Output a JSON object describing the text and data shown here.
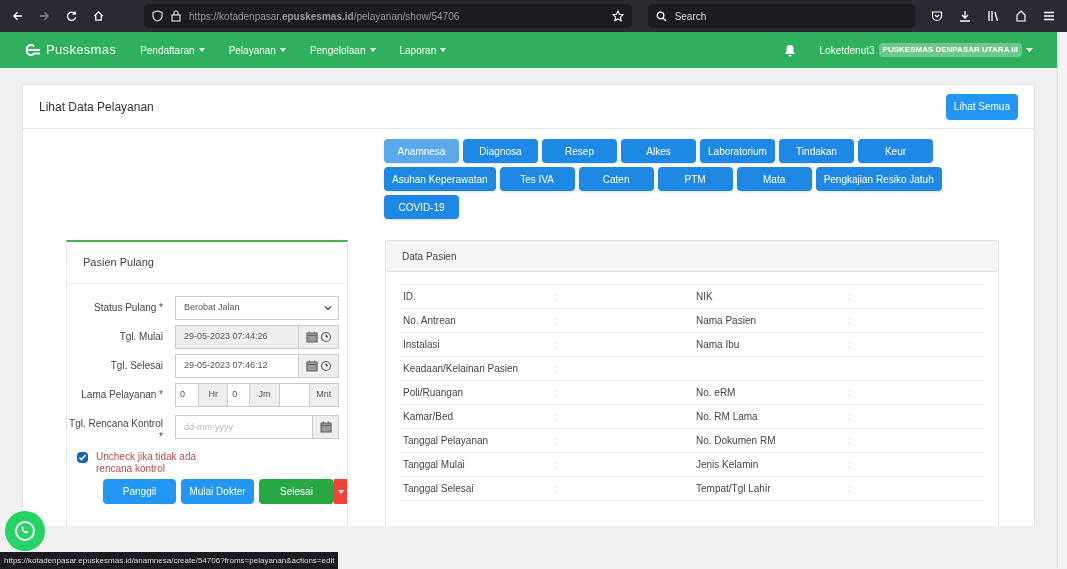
{
  "browser": {
    "url": "https://kotadenpasar.**epuskesmas.id**/pelayanan/show/54706",
    "search_placeholder": "Search"
  },
  "navbar": {
    "brand": "Puskesmas",
    "menus": [
      {
        "label": "Pendaftaran"
      },
      {
        "label": "Pelayanan"
      },
      {
        "label": "Pengelolaan"
      },
      {
        "label": "Laporan"
      }
    ],
    "user": "Loketdenut3",
    "facility": "PUSKESMAS DENPASAR UTARA III"
  },
  "page": {
    "title": "Lihat Data Pelayanan",
    "action": "Lihat Semua"
  },
  "tabs": [
    {
      "label": "Anamnesa",
      "selected": true
    },
    {
      "label": "Diagnosa",
      "selected": false
    },
    {
      "label": "Resep",
      "selected": false
    },
    {
      "label": "Alkes",
      "selected": false
    },
    {
      "label": "Laboratorium",
      "selected": false
    },
    {
      "label": "Tindakan",
      "selected": false
    },
    {
      "label": "Keur",
      "selected": false
    },
    {
      "label": "Asuhan Keperawatan",
      "selected": false
    },
    {
      "label": "Tes IVA",
      "selected": false
    },
    {
      "label": "Caten",
      "selected": false
    },
    {
      "label": "PTM",
      "selected": false
    },
    {
      "label": "Mata",
      "selected": false
    },
    {
      "label": "Pengkajian Resiko Jatuh",
      "selected": false
    },
    {
      "label": "COVID-19",
      "selected": false
    }
  ],
  "discharge": {
    "title": "Pasien Pulang",
    "fields": [
      {
        "kind": "select",
        "label": "Status Pulang *",
        "value": "Berobat Jalan",
        "disabled": false
      },
      {
        "kind": "datetime",
        "label": "Tgl. Mulai",
        "value": "29-05-2023 07:44:26",
        "disabled": true
      },
      {
        "kind": "datetime",
        "label": "Tgl. Selesai",
        "value": "29-05-2023 07:46:12",
        "disabled": false
      },
      {
        "kind": "duration",
        "label": "Lama Pelayanan *",
        "parts": [
          {
            "value": "0",
            "unit": "Hr"
          },
          {
            "value": "0",
            "unit": "Jm"
          },
          {
            "unit": "Mnt"
          }
        ]
      },
      {
        "kind": "date",
        "label": "Tgl. Rencana Kontrol *",
        "placeholder": "dd-mm-yyyy"
      }
    ],
    "checkbox": {
      "label": "Uncheck jika tidak ada rencana kontrol",
      "checked": true
    },
    "buttons": [
      {
        "label": "Panggil",
        "kind": "primary"
      },
      {
        "label": "Mulai Dokter",
        "kind": "primary"
      },
      {
        "label": "Selesai",
        "kind": "success"
      }
    ]
  },
  "patient": {
    "title": "Data Pasien",
    "rows": [
      {
        "left": {
          "label": "ID.",
          "colon": ":"
        },
        "right": {
          "label": "NIK",
          "colon": ":"
        }
      },
      {
        "left": {
          "label": "No. Antrean",
          "colon": ":"
        },
        "right": {
          "label": "Nama Pasien",
          "colon": ":"
        }
      },
      {
        "left": {
          "label": "Instalasi",
          "colon": ":"
        },
        "right": {
          "label": "Nama Ibu",
          "colon": ":"
        }
      },
      {
        "left": {
          "label": "Keadaan/Kelainan Pasien",
          "colon": ":"
        }
      },
      {
        "left": {
          "label": "Poli/Ruangan",
          "colon": ":"
        },
        "right": {
          "label": "No. eRM",
          "colon": ":"
        }
      },
      {
        "left": {
          "label": "Kamar/Bed",
          "colon": ":"
        },
        "right": {
          "label": "No. RM Lama",
          "colon": ":"
        }
      },
      {
        "left": {
          "label": "Tanggal Pelayanan",
          "colon": ":"
        },
        "right": {
          "label": "No. Dokumen RM",
          "colon": ":"
        }
      },
      {
        "left": {
          "label": "Tanggal Mulai",
          "colon": ":"
        },
        "right": {
          "label": "Jenis Kelamin",
          "colon": ":"
        }
      },
      {
        "left": {
          "label": "Tanggal Selesai",
          "colon": ":"
        },
        "right": {
          "label": "Tempat/Tgl Lahir",
          "colon": ":"
        }
      }
    ]
  },
  "status_bar": {
    "url": "https://kotadenpasar.epuskesmas.id/anamnesa/create/54706?froms=pelayanan&actions=edit"
  }
}
